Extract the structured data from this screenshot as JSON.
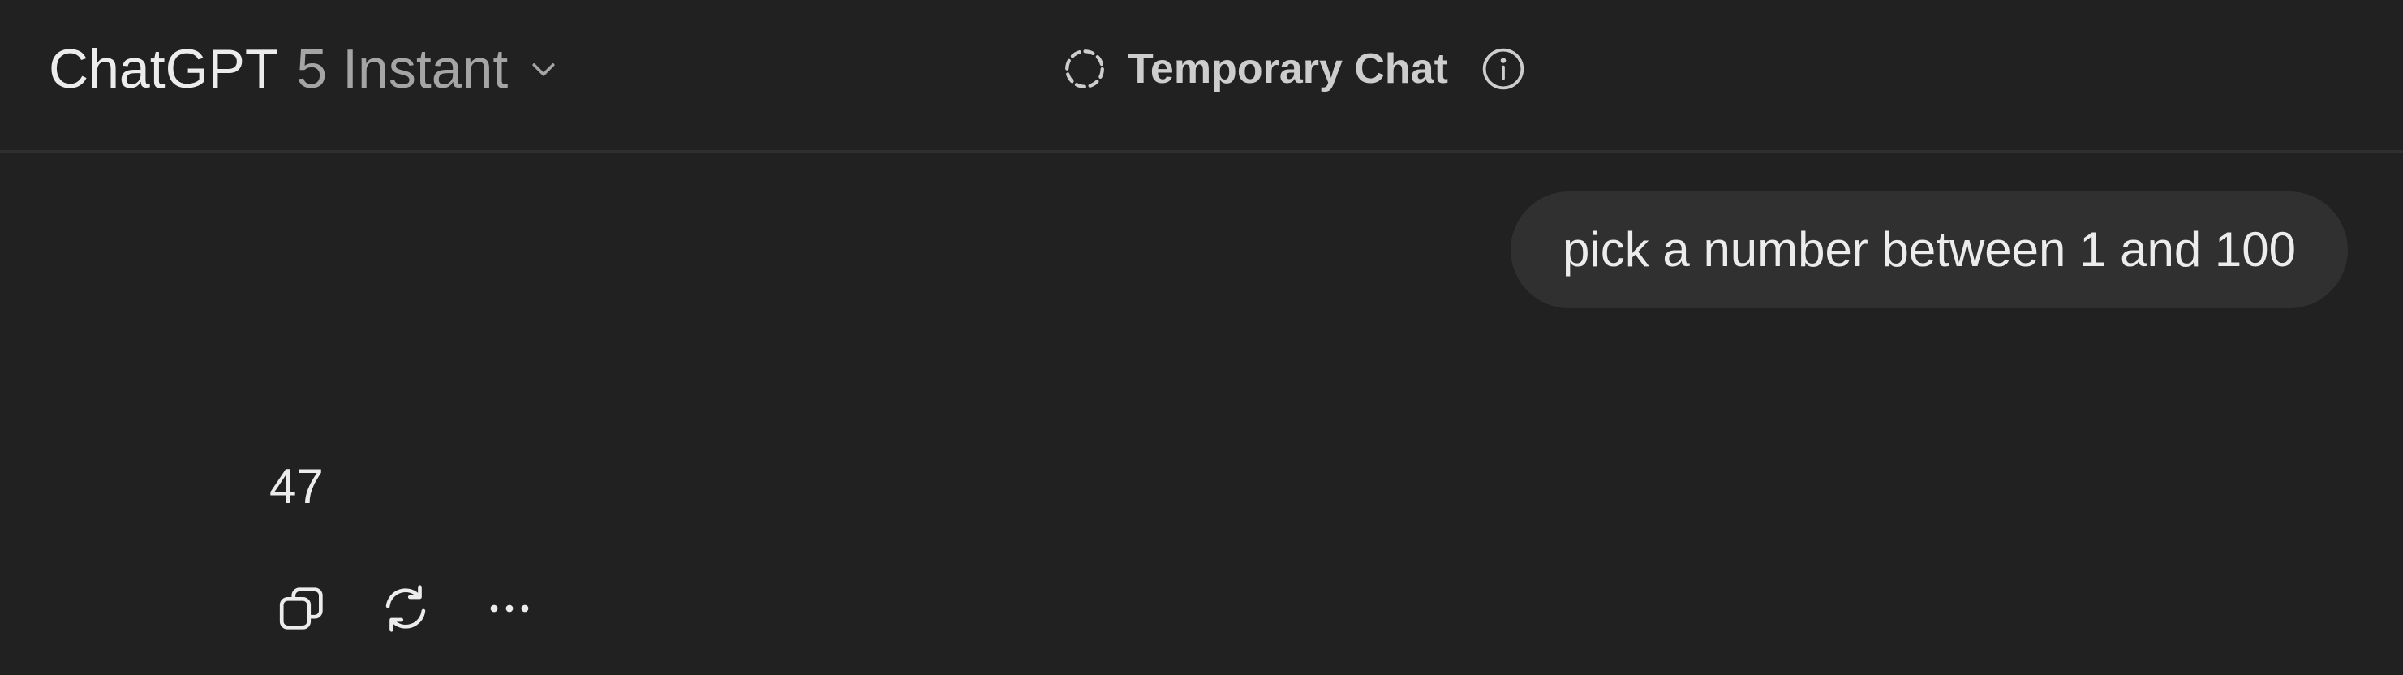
{
  "header": {
    "brand": "ChatGPT",
    "model": "5 Instant",
    "model_dropdown_icon": "chevron-down-icon",
    "temporary_chat_icon": "dashed-circle-icon",
    "temporary_chat_label": "Temporary Chat",
    "info_icon": "info-icon"
  },
  "conversation": {
    "user_message": "pick a number between 1 and 100",
    "assistant_message": "47"
  },
  "message_actions": {
    "copy_icon": "copy-icon",
    "regenerate_icon": "refresh-icon",
    "more_icon": "more-icon"
  },
  "colors": {
    "background": "#212121",
    "user_bubble": "#303030",
    "text": "#ececec",
    "muted_text": "#a5a5a5"
  }
}
